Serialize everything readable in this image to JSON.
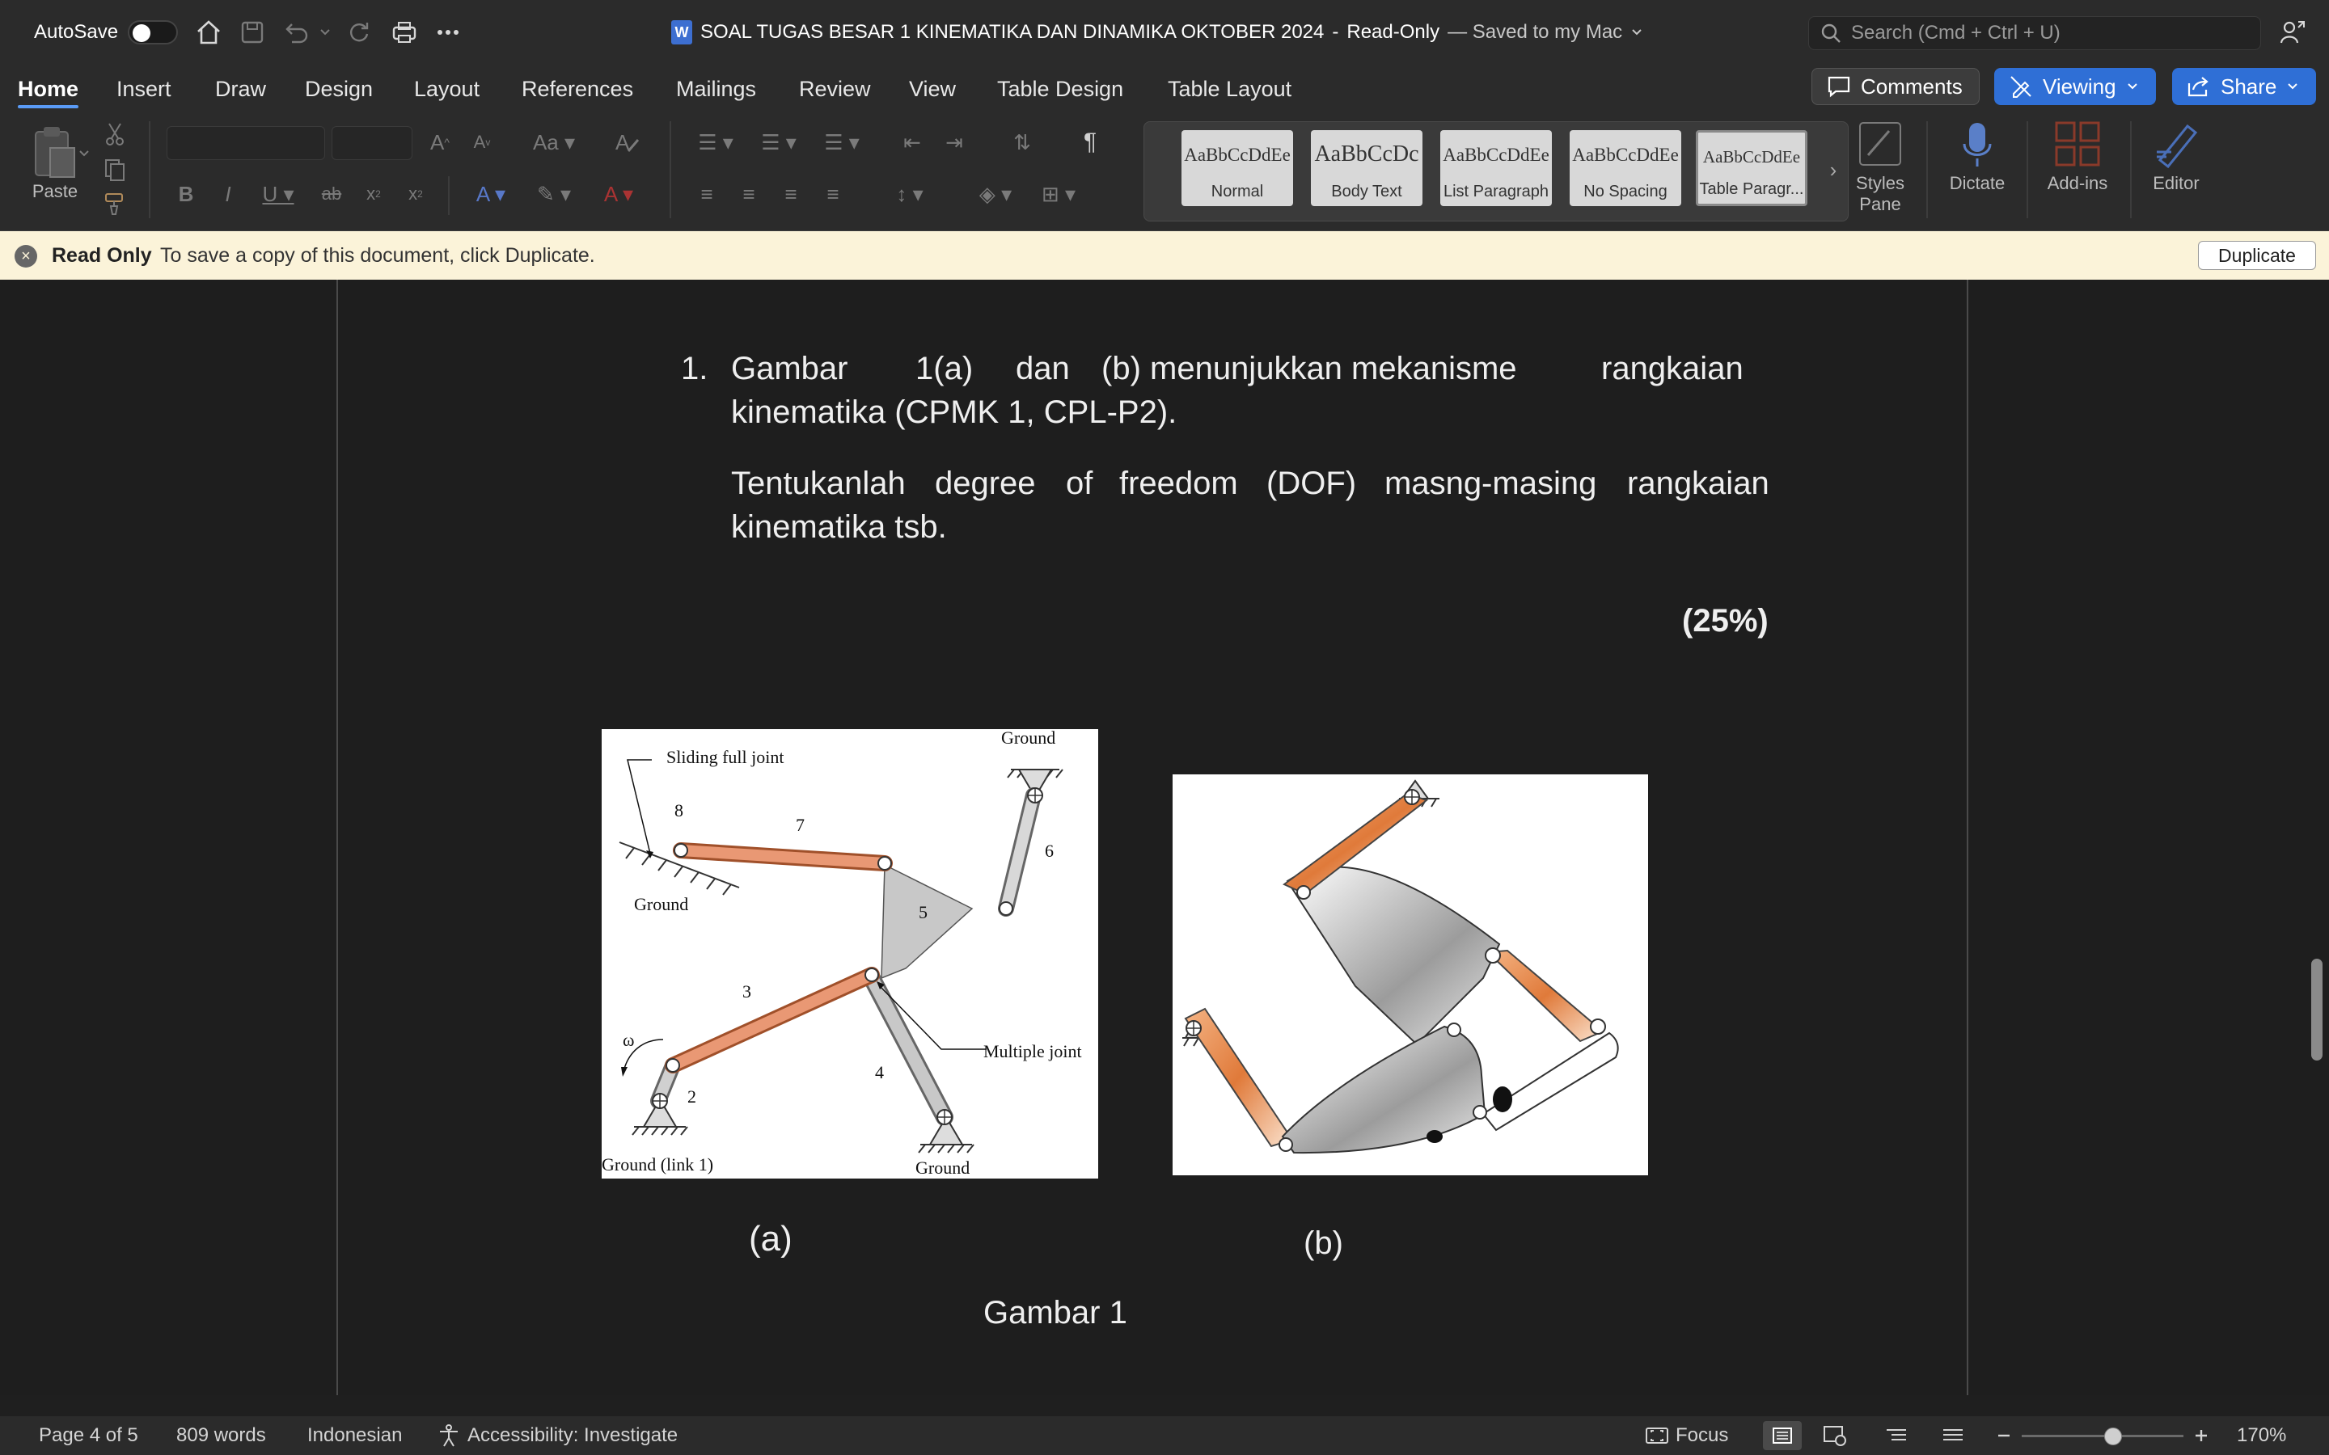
{
  "titlebar": {
    "autosave_label": "AutoSave",
    "doc_title": "SOAL TUGAS BESAR 1 KINEMATIKA DAN DINAMIKA OKTOBER 2024",
    "separator": "-",
    "readonly_label": "Read-Only",
    "saved_label": "— Saved to my Mac",
    "search_placeholder": "Search (Cmd + Ctrl + U)"
  },
  "ribbon_tabs": [
    "Home",
    "Insert",
    "Draw",
    "Design",
    "Layout",
    "References",
    "Mailings",
    "Review",
    "View",
    "Table Design",
    "Table Layout"
  ],
  "actions": {
    "comments": "Comments",
    "viewing": "Viewing",
    "share": "Share"
  },
  "ribbon": {
    "paste": "Paste",
    "styles": [
      {
        "sample": "AaBbCcDdEe",
        "name": "Normal"
      },
      {
        "sample": "AaBbCcDc",
        "name": "Body Text"
      },
      {
        "sample": "AaBbCcDdEe",
        "name": "List Paragraph"
      },
      {
        "sample": "AaBbCcDdEe",
        "name": "No Spacing"
      },
      {
        "sample": "AaBbCcDdEe",
        "name": "Table Paragr..."
      }
    ],
    "styles_pane": "Styles Pane",
    "dictate": "Dictate",
    "addins": "Add-ins",
    "editor": "Editor",
    "accent_color": "#2f6fd6"
  },
  "readonly_bar": {
    "title": "Read Only",
    "message": "To save a copy of this document, click Duplicate.",
    "button": "Duplicate"
  },
  "document": {
    "item_number": "1.",
    "line1_words": [
      "Gambar",
      "1(a)",
      "dan",
      "(b)",
      "menunjukkan mekanisme",
      "rangkaian"
    ],
    "line2": "kinematika (CPMK 1, CPL-P2).",
    "line3_words": [
      "Tentukanlah",
      "degree",
      "of",
      "freedom",
      "(DOF)",
      "masng-masing",
      "rangkaian"
    ],
    "line4": "kinematika tsb.",
    "score": "(25%)",
    "caption_a": "(a)",
    "caption_b": "(b)",
    "figure_caption": "Gambar 1"
  },
  "figure_a": {
    "labels": {
      "ground_top": "Ground",
      "sliding": "Sliding full joint",
      "n8": "8",
      "n7": "7",
      "n6": "6",
      "n5": "5",
      "ground_left": "Ground",
      "n3": "3",
      "omega": "ω",
      "multiple": "Multiple joint",
      "n4": "4",
      "n2": "2",
      "ground_link1": "Ground  (link 1)",
      "ground_bottom": "Ground"
    }
  },
  "statusbar": {
    "page": "Page 4 of 5",
    "words": "809 words",
    "language": "Indonesian",
    "accessibility": "Accessibility: Investigate",
    "focus": "Focus",
    "zoom": "170%"
  }
}
